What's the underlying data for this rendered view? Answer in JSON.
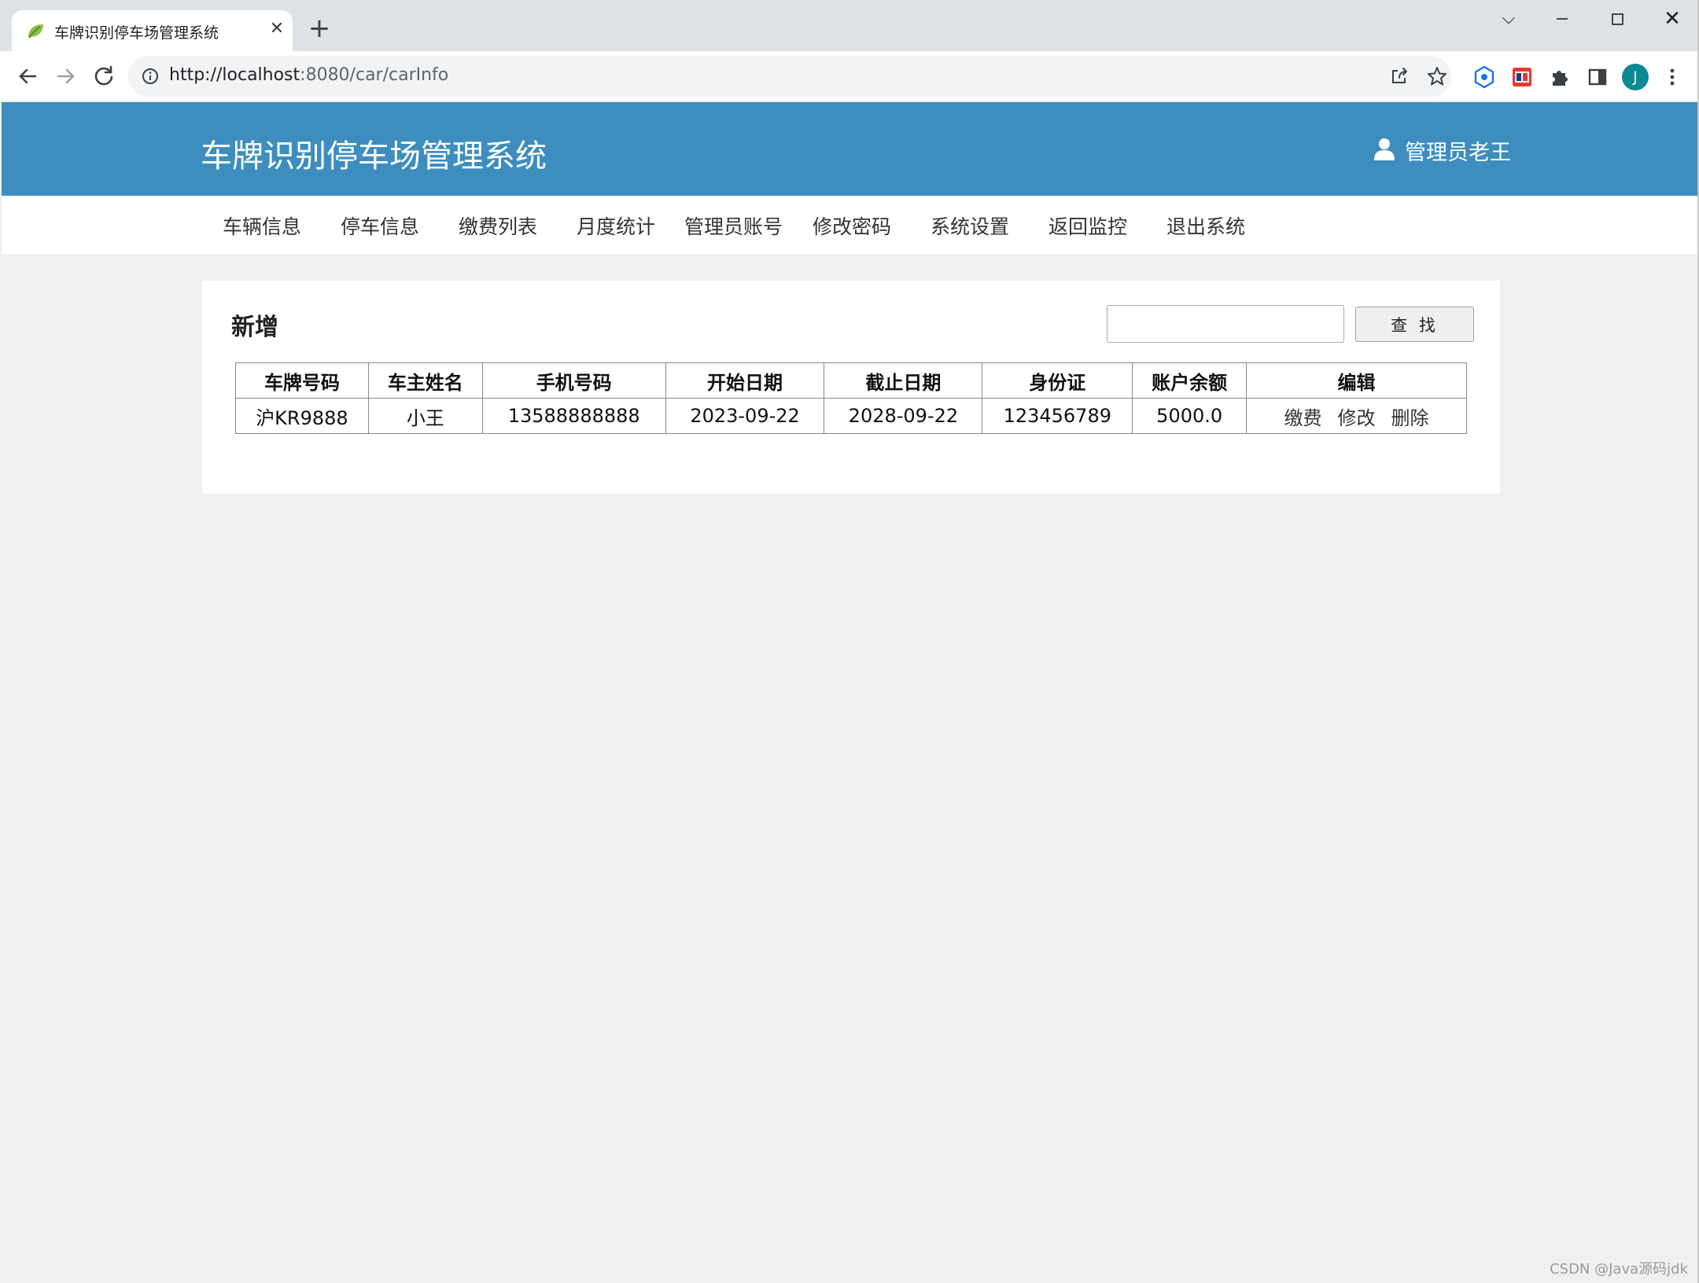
{
  "browser": {
    "tab_title": "车牌识别停车场管理系统",
    "tab_close_glyph": "✕",
    "new_tab_glyph": "+",
    "url_host": "http://localhost",
    "url_rest": ":8080/car/carInfo",
    "profile_initial": "J",
    "icons": {
      "favicon": "leaf-icon",
      "back": "back-arrow-icon",
      "forward": "forward-arrow-icon",
      "reload": "reload-icon",
      "info": "info-icon",
      "share": "share-icon",
      "bookmark": "star-icon",
      "extensions": [
        "hexagon-extension-icon",
        "fe-extension-icon",
        "puzzle-icon",
        "side-panel-icon"
      ],
      "menu": "kebab-menu-icon"
    }
  },
  "window_controls": {
    "chevron_glyph": "⌵",
    "close_glyph": "✕"
  },
  "header": {
    "title": "车牌识别停车场管理系统",
    "user_name": "管理员老王",
    "background_color": "#3d8ebe"
  },
  "nav": {
    "items": [
      {
        "label": "车辆信息"
      },
      {
        "label": "停车信息"
      },
      {
        "label": "缴费列表"
      },
      {
        "label": "月度统计"
      },
      {
        "label": "管理员账号"
      },
      {
        "label": "修改密码"
      },
      {
        "label": "系统设置"
      },
      {
        "label": "返回监控"
      },
      {
        "label": "退出系统"
      }
    ]
  },
  "main": {
    "add_label": "新增",
    "search": {
      "value": "",
      "button_label": "查 找"
    },
    "table": {
      "headers": [
        "车牌号码",
        "车主姓名",
        "手机号码",
        "开始日期",
        "截止日期",
        "身份证",
        "账户余额",
        "编辑"
      ],
      "rows": [
        {
          "plate": "沪KR9888",
          "owner": "小王",
          "phone": "13588888888",
          "start_date": "2023-09-22",
          "end_date": "2028-09-22",
          "id_card": "123456789",
          "balance": "5000.0",
          "actions": [
            "缴费",
            "修改",
            "删除"
          ]
        }
      ]
    }
  },
  "watermark": "CSDN @Java源码jdk"
}
